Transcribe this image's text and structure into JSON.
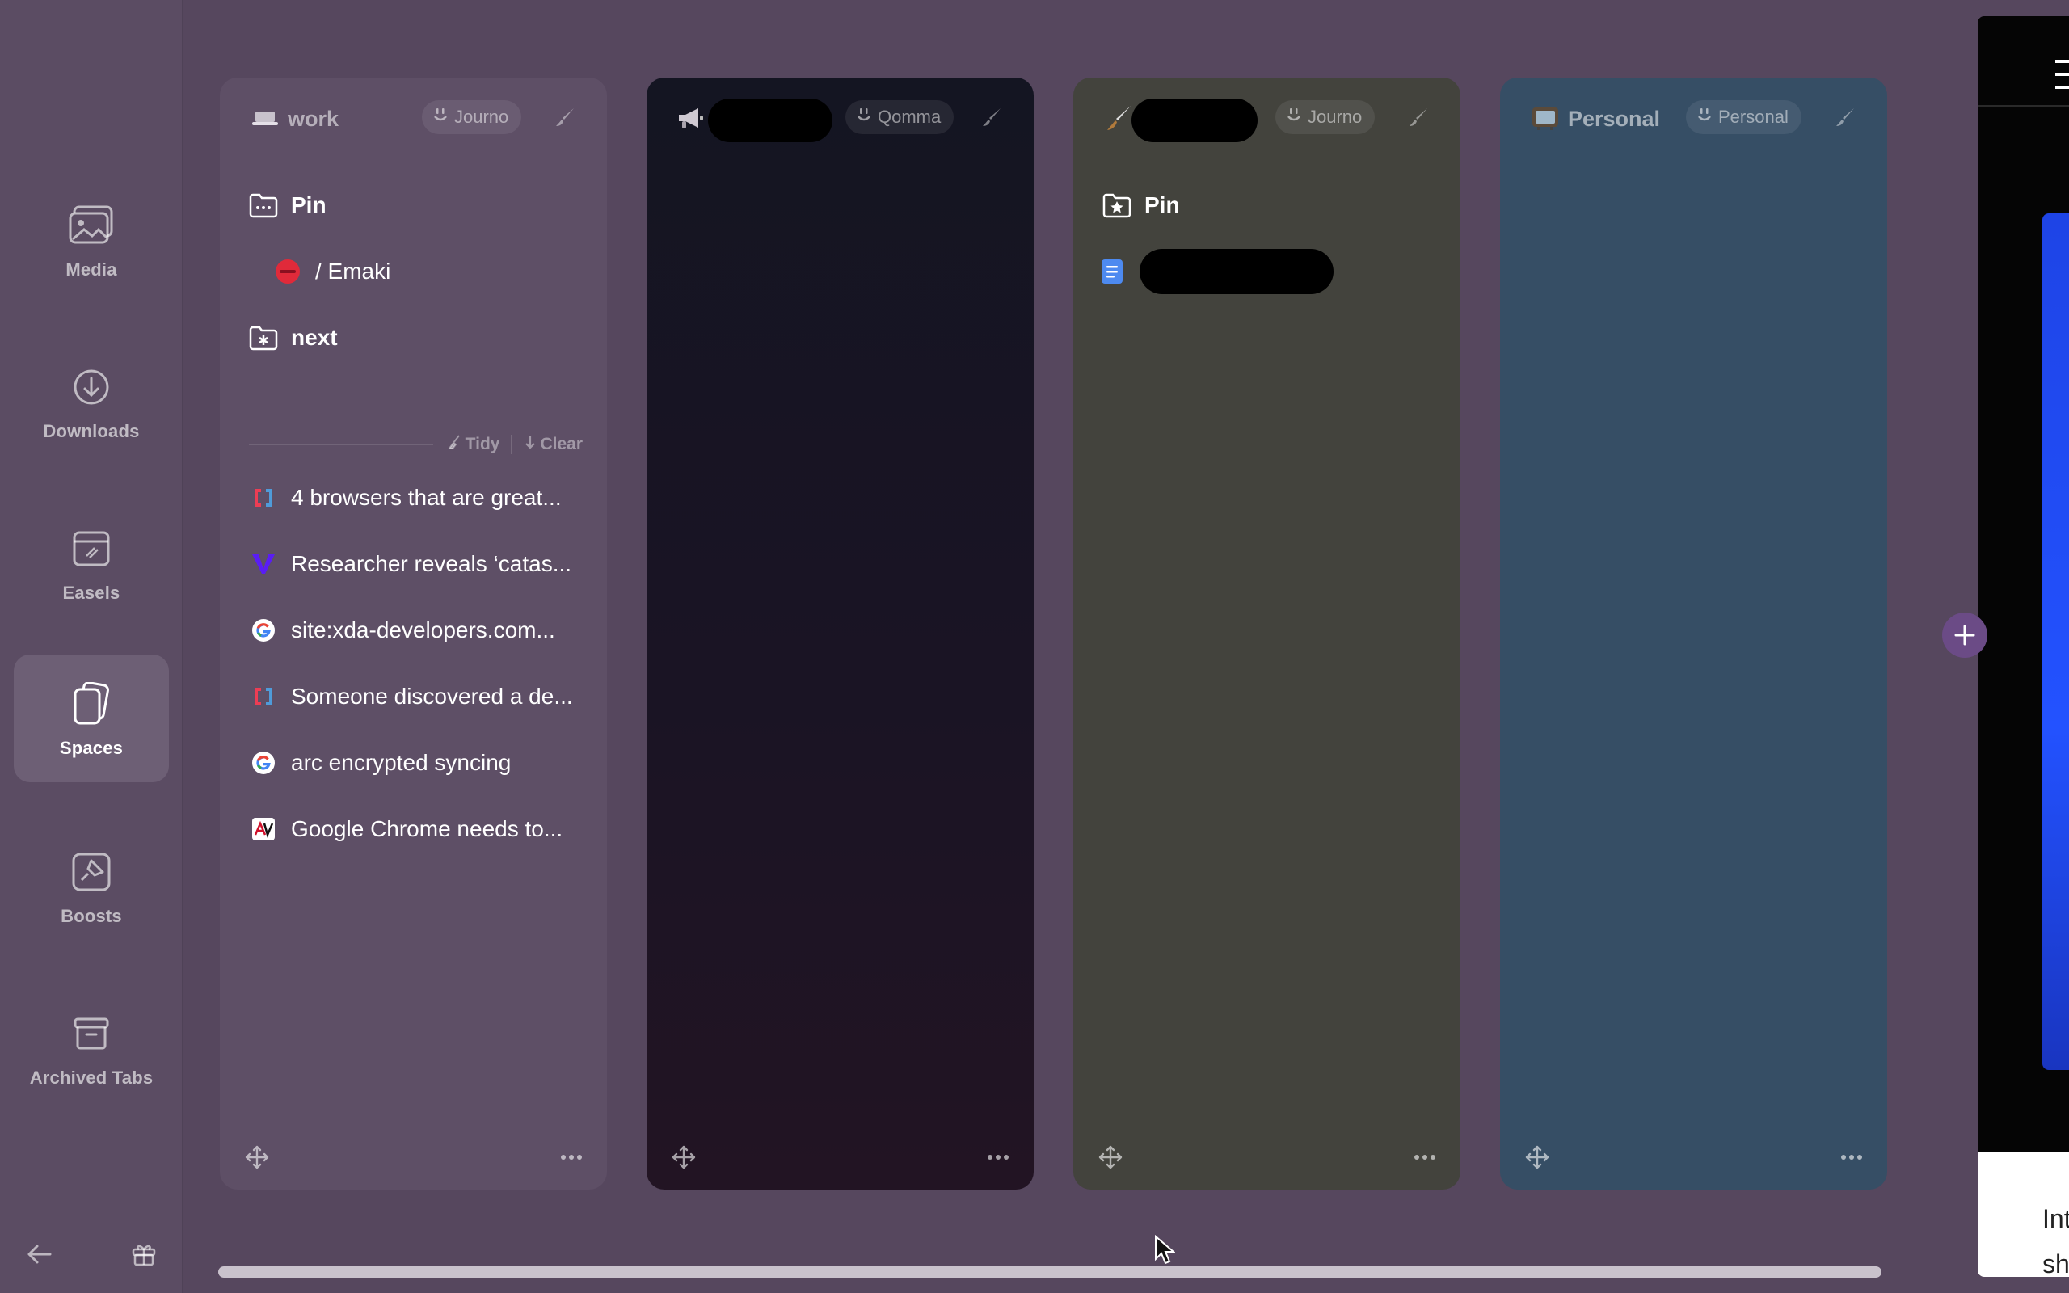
{
  "sidebar": {
    "items": [
      {
        "label": "Media",
        "icon": "media-icon",
        "active": false
      },
      {
        "label": "Downloads",
        "icon": "download-icon",
        "active": false
      },
      {
        "label": "Easels",
        "icon": "easel-icon",
        "active": false
      },
      {
        "label": "Spaces",
        "icon": "spaces-icon",
        "active": true
      },
      {
        "label": "Boosts",
        "icon": "boost-icon",
        "active": false
      },
      {
        "label": "Archived Tabs",
        "icon": "archive-icon",
        "active": false
      }
    ],
    "bottom": {
      "back_icon": "arrow-left-icon",
      "gift_icon": "gift-icon"
    }
  },
  "spaces": [
    {
      "title": "work",
      "icon": "laptop-icon",
      "profile": "Journo",
      "color": "#5e4f66",
      "pinned": [
        {
          "label": "Pin",
          "icon": "folder-dots-icon"
        },
        {
          "label": "/ Emaki",
          "icon": "emaki-favicon"
        },
        {
          "label": "next",
          "icon": "folder-asterisk-icon"
        }
      ],
      "actions": {
        "tidy": "Tidy",
        "clear": "Clear"
      },
      "tabs": [
        {
          "label": "4 browsers that are great...",
          "icon": "xda-favicon"
        },
        {
          "label": "Researcher reveals ‘catas...",
          "icon": "verge-favicon"
        },
        {
          "label": "site:xda-developers.com...",
          "icon": "google-favicon"
        },
        {
          "label": "Someone discovered a de...",
          "icon": "xda-favicon"
        },
        {
          "label": "arc encrypted syncing",
          "icon": "google-favicon"
        },
        {
          "label": "Google Chrome needs to...",
          "icon": "androidpolice-favicon"
        }
      ]
    },
    {
      "title": "",
      "icon": "megaphone-icon",
      "profile": "Qomma",
      "color": "#1a1420"
    },
    {
      "title": "",
      "icon": "paintbrush-icon",
      "profile": "Journo",
      "color": "#43433d",
      "pinned": [
        {
          "label": "Pin",
          "icon": "folder-star-icon"
        }
      ],
      "tabs": [
        {
          "label": "",
          "icon": "docs-favicon"
        }
      ]
    },
    {
      "title": "Personal",
      "icon": "tv-icon",
      "profile": "Personal",
      "color": "#364e65"
    }
  ],
  "preview": {
    "text_lines": [
      "Int",
      "sh"
    ]
  },
  "colors": {
    "background": "#56475e",
    "sidebar": "#5b4c63",
    "accent": "#6b4b86"
  }
}
